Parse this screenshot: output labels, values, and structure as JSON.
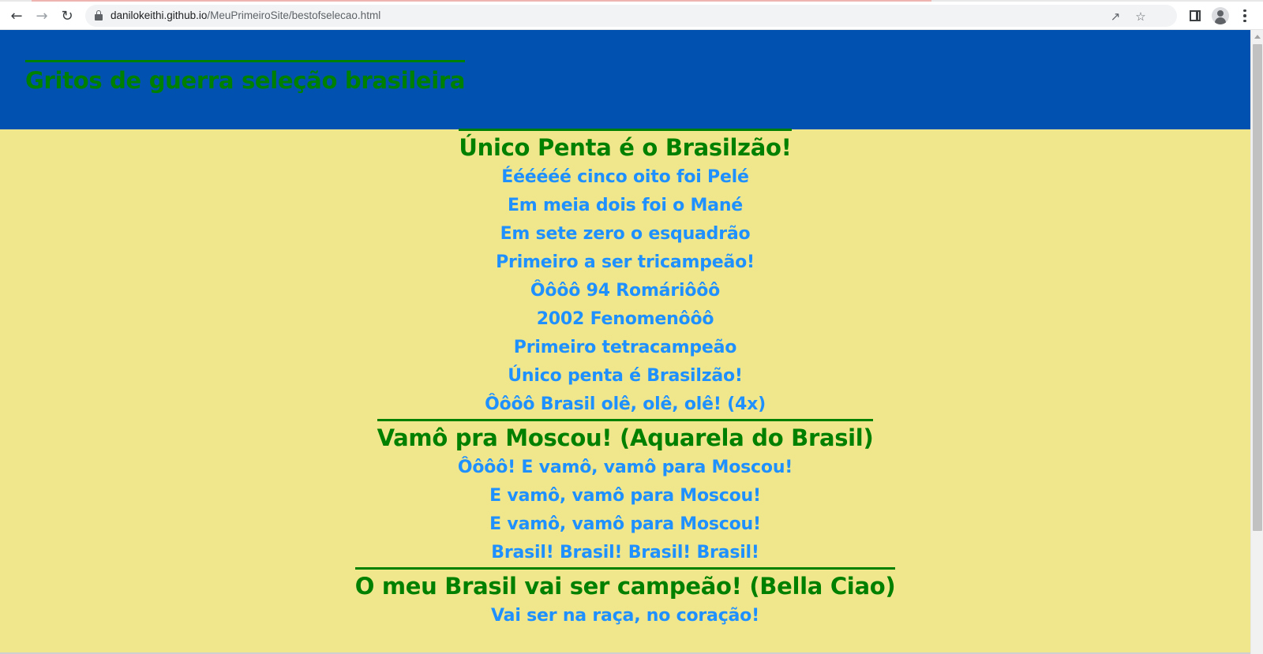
{
  "browser": {
    "url_host": "danilokeithi.github.io",
    "url_path": "/MeuPrimeiroSite/bestofselecao.html",
    "icons": [
      "back-arrow-icon",
      "forward-arrow-icon",
      "reload-icon",
      "lock-icon",
      "share-icon",
      "star-icon",
      "side-panel-icon",
      "profile-icon",
      "more-menu-icon"
    ]
  },
  "page": {
    "title": "Gritos de guerra seleção brasileira",
    "colors": {
      "header_bg": "#0051b0",
      "body_bg": "#f0e68c",
      "heading": "#008000",
      "lyrics": "#1e90ff"
    },
    "songs": [
      {
        "title": "Único Penta é o Brasilzão!",
        "lines": [
          "Éééééé cinco oito foi Pelé",
          "Em meia dois foi o Mané",
          "Em sete zero o esquadrão",
          "Primeiro a ser tricampeão!",
          "Ôôôô 94 Romáriôôô",
          "2002 Fenomenôôô",
          "Primeiro tetracampeão",
          "Único penta é Brasilzão!",
          "Ôôôô Brasil olê, olê, olê! (4x)"
        ]
      },
      {
        "title": "Vamô pra Moscou! (Aquarela do Brasil)",
        "lines": [
          "Ôôôô! E vamô, vamô para Moscou!",
          "E vamô, vamô para Moscou!",
          "E vamô, vamô para Moscou!",
          "Brasil! Brasil! Brasil! Brasil!"
        ]
      },
      {
        "title": "O meu Brasil vai ser campeão! (Bella Ciao)",
        "lines": [
          "Vai ser na raça, no coração!"
        ]
      }
    ]
  }
}
